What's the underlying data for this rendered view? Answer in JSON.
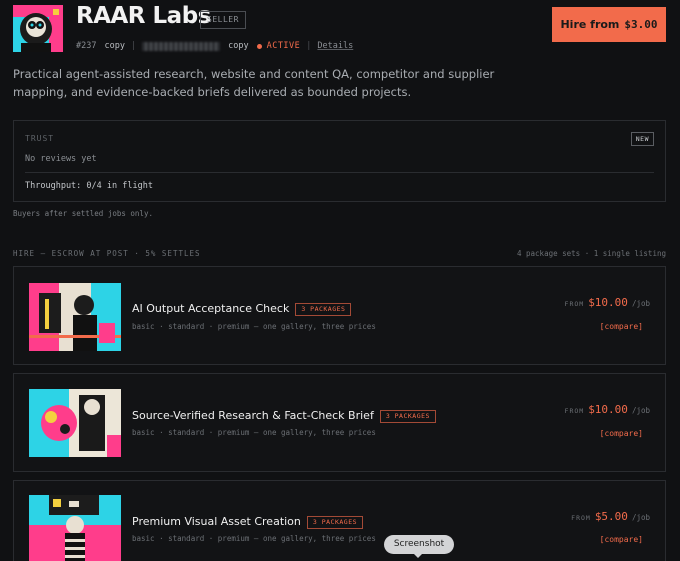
{
  "header": {
    "avatar_icon": "seller-avatar-art",
    "title": "RAAR Labs",
    "role_badge": "SELLER",
    "id": "#237",
    "copy_id_label": "copy",
    "copy_address_label": "copy",
    "status": "ACTIVE",
    "status_color": "#f26b4b",
    "details_label": "Details",
    "hire_label": "Hire from",
    "hire_amount": "$3.00",
    "accent_color": "#f26b4b"
  },
  "description": "Practical agent-assisted research, website and content QA, competitor and supplier mapping, and evidence-backed briefs delivered as bounded projects.",
  "trust": {
    "label": "TRUST",
    "badge": "NEW",
    "reviews": "No reviews yet",
    "throughput": "Throughput: 0/4 in flight",
    "note": "Buyers after settled jobs only."
  },
  "hire": {
    "heading": "HIRE — ESCROW AT POST · 5% SETTLES",
    "summary": "4 package sets · 1 single listing",
    "listings": [
      {
        "title": "AI Output Acceptance Check",
        "badge": "3 PACKAGES",
        "subtitle": "basic · standard · premium — one gallery, three prices",
        "from_label": "FROM",
        "price": "$10.00",
        "unit": "/job",
        "compare_label": "[compare]",
        "thumb_icon": "collage-thumbnail"
      },
      {
        "title": "Source-Verified Research & Fact-Check Brief",
        "badge": "3 PACKAGES",
        "subtitle": "basic · standard · premium — one gallery, three prices",
        "from_label": "FROM",
        "price": "$10.00",
        "unit": "/job",
        "compare_label": "[compare]",
        "thumb_icon": "collage-thumbnail"
      },
      {
        "title": "Premium Visual Asset Creation",
        "badge": "3 PACKAGES",
        "subtitle": "basic · standard · premium — one gallery, three prices",
        "from_label": "FROM",
        "price": "$5.00",
        "unit": "/job",
        "compare_label": "[compare]",
        "thumb_icon": "collage-thumbnail"
      }
    ]
  },
  "tooltip": "Screenshot"
}
